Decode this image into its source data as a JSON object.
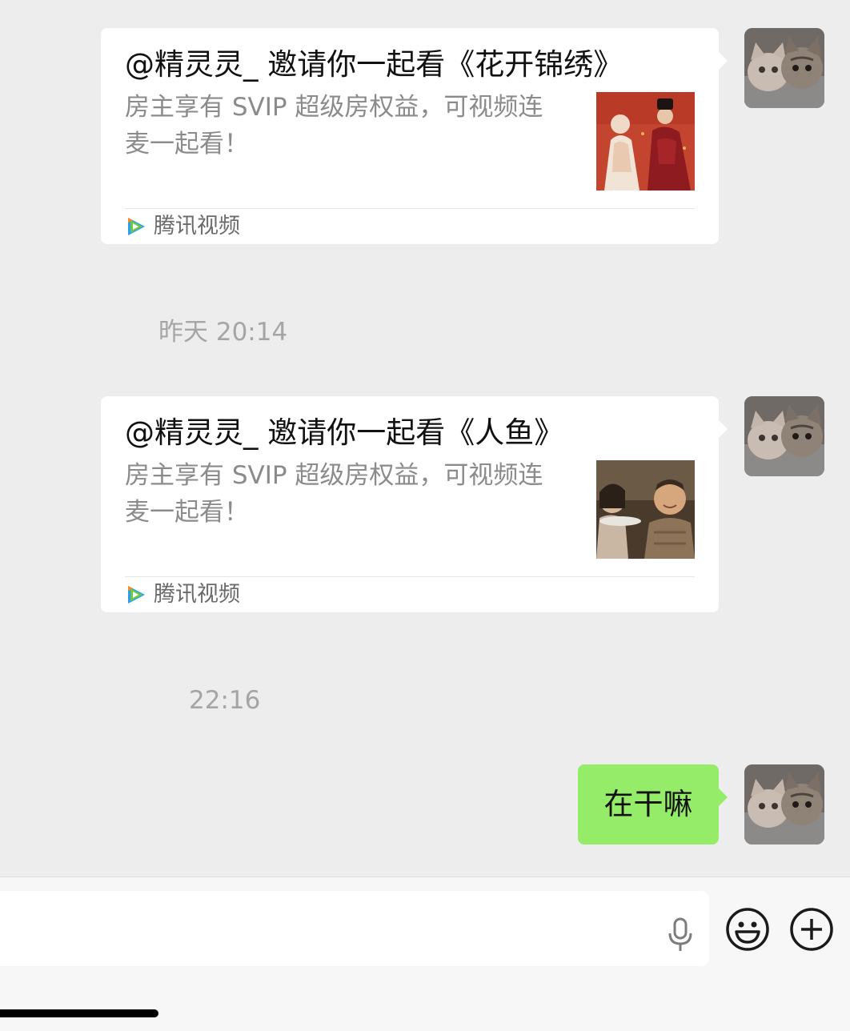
{
  "messages": [
    {
      "type": "share-card",
      "title": "@精灵灵_ 邀请你一起看《花开锦绣》",
      "description": "房主享有 SVIP 超级房权益，可视频连麦一起看！",
      "source": "腾讯视频",
      "thumbnail": "costume-drama-poster"
    },
    {
      "type": "timestamp",
      "text": "昨天 20:14"
    },
    {
      "type": "share-card",
      "title": "@精灵灵_ 邀请你一起看《人鱼》",
      "description": "房主享有 SVIP 超级房权益，可视频连麦一起看！",
      "source": "腾讯视频",
      "thumbnail": "movie-still"
    },
    {
      "type": "timestamp",
      "text": "22:16"
    },
    {
      "type": "text",
      "text": "在干嘛"
    }
  ],
  "avatar": "kittens-photo",
  "input": {
    "value": "",
    "icons": [
      "microphone-icon",
      "emoji-icon",
      "plus-icon"
    ]
  },
  "colors": {
    "chat_background": "#ededed",
    "card_background": "#ffffff",
    "sent_bubble": "#95ec69",
    "timestamp_text": "#a5a5a5",
    "description_text": "#8b8b8b"
  }
}
